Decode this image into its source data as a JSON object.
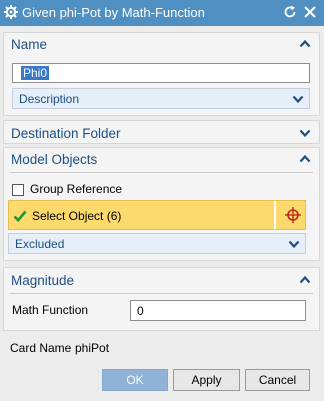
{
  "window": {
    "title": "Given phi-Pot by Math-Function"
  },
  "sections": {
    "name": {
      "label": "Name",
      "value": "Phi0",
      "description_label": "Description"
    },
    "destination": {
      "label": "Destination Folder"
    },
    "model_objects": {
      "label": "Model Objects",
      "group_reference_label": "Group Reference",
      "group_reference_checked": false,
      "select_object_label": "Select Object (6)",
      "excluded_label": "Excluded"
    },
    "magnitude": {
      "label": "Magnitude",
      "math_function_label": "Math Function",
      "math_function_value": "0"
    }
  },
  "card": {
    "key": "Card Name",
    "value": "phiPot"
  },
  "buttons": {
    "ok": "OK",
    "apply": "Apply",
    "cancel": "Cancel"
  },
  "colors": {
    "titlebar": "#4f8fc1",
    "section_title": "#1d4f83",
    "selection_highlight": "#fcd96c",
    "ok_button": "#8fb2d6"
  },
  "icons": {
    "title_left": "gear-icon",
    "title_reset": "reset-icon",
    "title_close": "close-icon",
    "expand": "chevron-up-icon",
    "collapse": "chevron-down-icon",
    "selected": "checkmark-icon",
    "picker": "crosshair-icon"
  }
}
